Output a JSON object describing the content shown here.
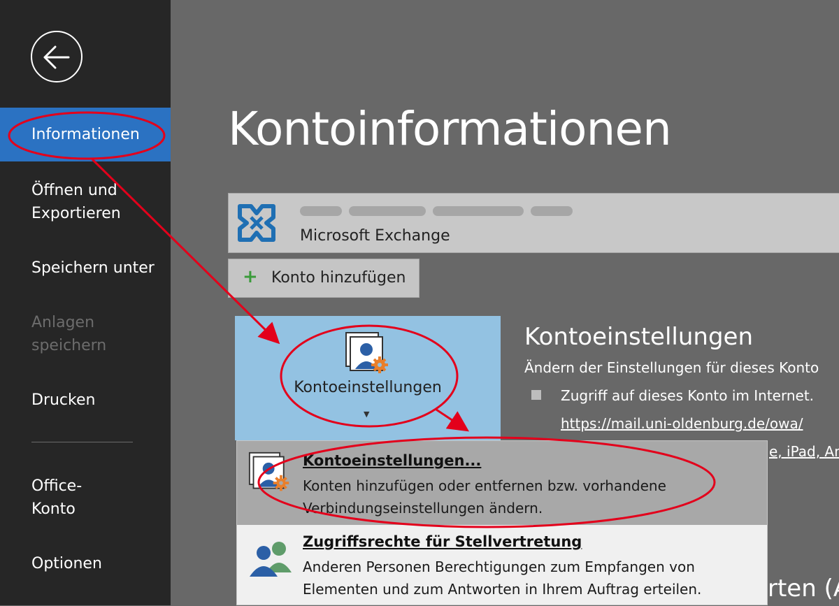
{
  "sidebar": {
    "items": [
      {
        "label": "Informationen"
      },
      {
        "label": "Öffnen und"
      },
      {
        "label": "Exportieren"
      },
      {
        "label": "Speichern unter"
      },
      {
        "label": "Anlagen"
      },
      {
        "label": "speichern"
      },
      {
        "label": "Drucken"
      },
      {
        "label": "Office-"
      },
      {
        "label": "Konto"
      },
      {
        "label": "Optionen"
      }
    ]
  },
  "main": {
    "title": "Kontoinformationen",
    "account": {
      "type": "Microsoft Exchange"
    },
    "add_account_label": "Konto hinzufügen",
    "tile_label": "Kontoeinstellungen",
    "section": {
      "title": "Kontoeinstellungen",
      "desc": "Ändern der Einstellungen für dieses Konto",
      "bullet": "Zugriff auf dieses Konto im Internet.",
      "link": "https://mail.uni-oldenburg.de/owa/",
      "partial": "e, iPad, An",
      "partial2": "rten (A"
    },
    "dropdown": {
      "items": [
        {
          "title": "Kontoeinstellungen...",
          "desc_line1": "Konten hinzufügen oder entfernen bzw. vorhandene",
          "desc_line2": "Verbindungseinstellungen ändern."
        },
        {
          "title": "Zugriffsrechte für Stellvertretung",
          "desc_line1": "Anderen Personen Berechtigungen zum Empfangen von",
          "desc_line2": "Elementen und zum Antworten in Ihrem Auftrag erteilen."
        }
      ]
    }
  },
  "colors": {
    "sidebar_bg": "#262626",
    "active_nav": "#2b72c2",
    "main_bg": "#686868",
    "tile_bg": "#93c2e2",
    "annotation_red": "#e3001b"
  }
}
